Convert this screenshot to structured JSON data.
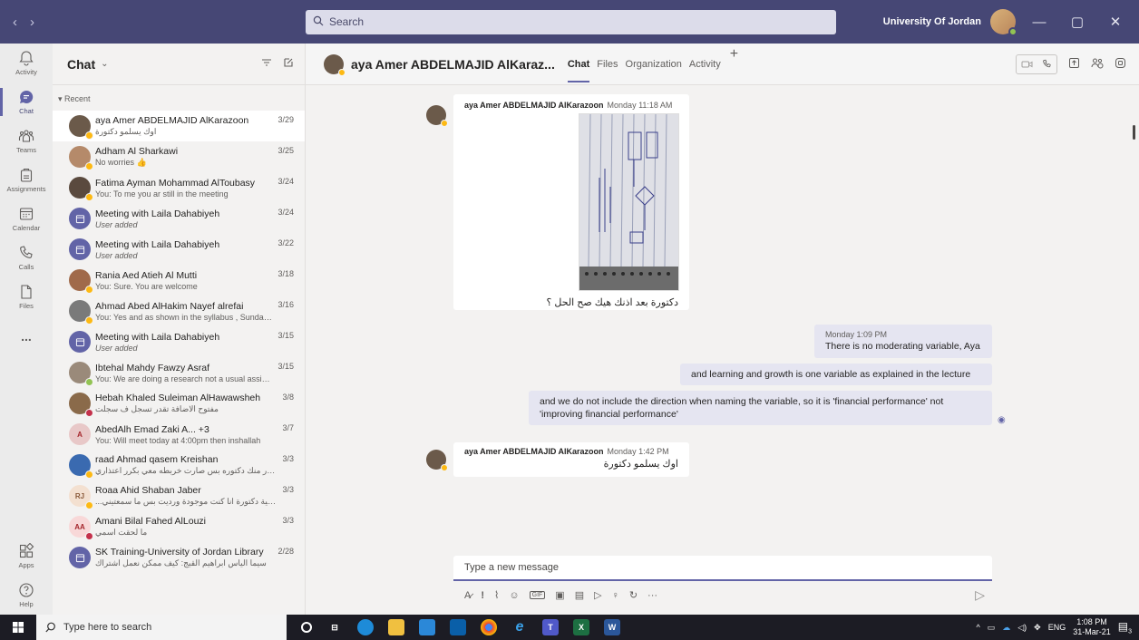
{
  "titlebar": {
    "back": "‹",
    "forward": "›",
    "search_placeholder": "Search",
    "org": "University Of Jordan",
    "minimize": "—",
    "maximize": "▢",
    "close": "✕"
  },
  "rail": [
    {
      "label": "Activity",
      "icon": "bell-icon"
    },
    {
      "label": "Chat",
      "icon": "chat-icon",
      "active": true
    },
    {
      "label": "Teams",
      "icon": "teams-icon"
    },
    {
      "label": "Assignments",
      "icon": "assignments-icon"
    },
    {
      "label": "Calendar",
      "icon": "calendar-icon"
    },
    {
      "label": "Calls",
      "icon": "phone-icon"
    },
    {
      "label": "Files",
      "icon": "file-icon"
    },
    {
      "label": "...",
      "icon": "more-icon"
    }
  ],
  "rail_bottom": [
    {
      "label": "Apps",
      "icon": "apps-icon"
    },
    {
      "label": "Help",
      "icon": "help-icon"
    }
  ],
  "chatlist": {
    "title": "Chat",
    "recent_label": "Recent",
    "items": [
      {
        "name": "aya Amer ABDELMAJID AlKarazoon",
        "preview": "اوك يسلمو دكتورة",
        "date": "3/29",
        "avatar_color": "#6b5a4a",
        "presence": "#fdb913",
        "rtl": true
      },
      {
        "name": "Adham Al Sharkawi",
        "preview": "No worries 👍",
        "date": "3/25",
        "avatar_color": "#b58a6a",
        "presence": "#fdb913"
      },
      {
        "name": "Fatima Ayman Mohammad AlToubasy",
        "preview": "You: To me you ar still in the meeting",
        "date": "3/24",
        "avatar_color": "#5a4a3e",
        "presence": "#fdb913"
      },
      {
        "name": "Meeting with Laila Dahabiyeh",
        "preview": "User added",
        "date": "3/24",
        "avatar_color": "#6264a7",
        "meeting": true
      },
      {
        "name": "Meeting with Laila Dahabiyeh",
        "preview": "User added",
        "date": "3/22",
        "avatar_color": "#6264a7",
        "meeting": true
      },
      {
        "name": "Rania Aed Atieh Al Mutti",
        "preview": "You: Sure. You are welcome",
        "date": "3/18",
        "avatar_color": "#a06a4a",
        "presence": "#fdb913"
      },
      {
        "name": "Ahmad Abed AlHakim Nayef alrefai",
        "preview": "You: Yes and as shown in the syllabus , Sunday - ...",
        "date": "3/16",
        "avatar_color": "#7a7a7a",
        "presence": "#fdb913"
      },
      {
        "name": "Meeting with Laila Dahabiyeh",
        "preview": "User added",
        "date": "3/15",
        "avatar_color": "#6264a7",
        "meeting": true
      },
      {
        "name": "Ibtehal Mahdy Fawzy Asraf",
        "preview": "You: We are doing a research not a usual assign...",
        "date": "3/15",
        "avatar_color": "#9a8a7a",
        "presence": "#92c353"
      },
      {
        "name": "Hebah Khaled Suleiman AlHawawsheh",
        "preview": "مفتوح الاضافة تقدر تسجل ف سجلت",
        "date": "3/8",
        "avatar_color": "#8a6a4a",
        "presence": "#c4314b",
        "rtl": true
      },
      {
        "name": "AbedAlh Emad Zaki A... +3",
        "preview": "You: Will meet today at 4:00pm then inshallah",
        "date": "3/7",
        "avatar_color": "#e8c8c8",
        "presence": "",
        "initials": "A",
        "initials_color": "#a4262c"
      },
      {
        "name": "raad Ahmad qasem Kreishan",
        "preview": "بعتذر منك دكتوره بس صارت خربطه معي بكرر اعتذاري",
        "date": "3/3",
        "avatar_color": "#3a6ab0",
        "presence": "#fdb913",
        "rtl": true
      },
      {
        "name": "Roaa Ahid Shaban Jaber",
        "preview": "...لعافية دكتورة انا كنت موجودة ورديت بس ما سمعتيني",
        "date": "3/3",
        "avatar_color": "#f3e0d0",
        "presence": "#fdb913",
        "initials": "RJ",
        "initials_color": "#8a5a3a",
        "rtl": true
      },
      {
        "name": "Amani Bilal Fahed AlLouzi",
        "preview": "ما لحقت اسمي",
        "date": "3/3",
        "avatar_color": "#f8d8d8",
        "presence": "#c4314b",
        "initials": "AA",
        "initials_color": "#a4262c",
        "rtl": true
      },
      {
        "name": "SK Training-University of Jordan Library",
        "preview": "سيما الياس ابراهيم القيج: كيف ممكن نعمل اشتراك",
        "date": "2/28",
        "avatar_color": "#6264a7",
        "meeting": true,
        "rtl": true
      }
    ]
  },
  "conversation": {
    "name": "aya Amer ABDELMAJID AlKaraz...",
    "tabs": [
      {
        "label": "Chat",
        "active": true
      },
      {
        "label": "Files"
      },
      {
        "label": "Organization"
      },
      {
        "label": "Activity"
      }
    ],
    "add_tab": "+",
    "messages": [
      {
        "sender": "aya Amer ABDELMAJID AlKarazoon",
        "time": "Monday 11:18 AM",
        "text": "دكتورة بعد اذنك هيك صح الحل ؟"
      },
      {
        "time": "Monday 1:09 PM",
        "text": "There is no moderating variable, Aya"
      },
      {
        "text": "and learning and growth is one variable as explained in the lecture"
      },
      {
        "text_line1": "and we do not include the direction when naming the variable, so it is 'financial performance' not",
        "text_line2": "'improving financial performance'"
      },
      {
        "sender": "aya Amer ABDELMAJID AlKarazoon",
        "time": "Monday 1:42 PM",
        "text": "اوك يسلمو دكتورة"
      }
    ],
    "compose_placeholder": "Type a new message"
  },
  "taskbar": {
    "search_placeholder": "Type here to search",
    "lang": "ENG",
    "time": "1:08 PM",
    "date": "31-Mar-21",
    "notifications": "3"
  },
  "colors": {
    "brand": "#6264a7",
    "titlebar": "#464775",
    "away": "#fdb913",
    "available": "#92c353",
    "busy": "#c4314b"
  }
}
